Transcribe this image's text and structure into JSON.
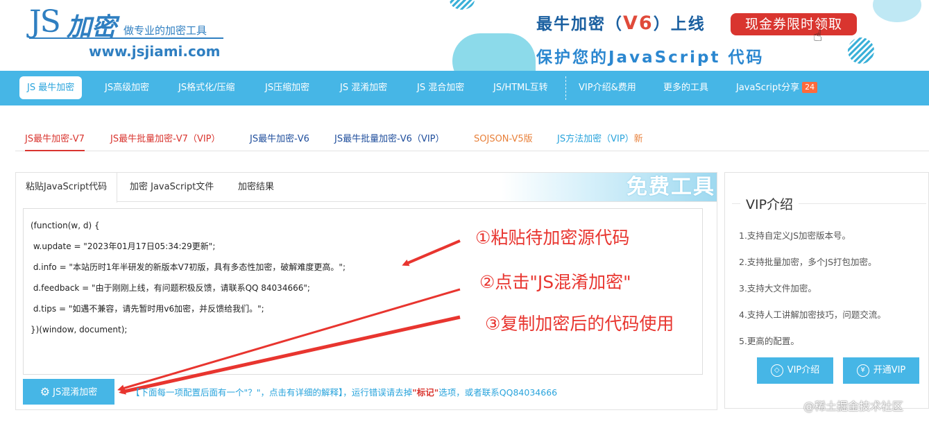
{
  "header": {
    "logo_js": "JS",
    "logo_cn": "加密",
    "logo_slogan": "做专业的加密工具",
    "logo_url": "www.jsjiami.com",
    "banner_title_pre": "最牛加密（",
    "banner_title_v6": "V6",
    "banner_title_post": "）上线",
    "banner_coupon": "现金券限时领取",
    "banner_sub": "保护您的JavaScript 代码"
  },
  "nav": {
    "items": [
      {
        "label": "JS 最牛加密"
      },
      {
        "label": "JS高级加密"
      },
      {
        "label": "JS格式化/压缩"
      },
      {
        "label": "JS压缩加密"
      },
      {
        "label": "JS 混淆加密"
      },
      {
        "label": "JS 混合加密"
      },
      {
        "label": "JS/HTML互转"
      },
      {
        "label": "VIP介绍&费用"
      },
      {
        "label": "更多的工具"
      },
      {
        "label": "JavaScript分享"
      }
    ],
    "share_badge": "24"
  },
  "subtabs": [
    {
      "label": "JS最牛加密-V7",
      "color": "#d9352f"
    },
    {
      "label": "JS最牛批量加密-V7（VIP）",
      "color": "#d9352f"
    },
    {
      "label": "JS最牛加密-V6",
      "color": "#1f4e9c"
    },
    {
      "label": "JS最牛批量加密-V6（VIP）",
      "color": "#1f4e9c"
    },
    {
      "label": "SOJSON-V5版",
      "color": "#e8803a"
    },
    {
      "label": "JS方法加密（VIP）",
      "color": "#2aa4dc"
    },
    {
      "label": "新",
      "color": "#e8803a"
    }
  ],
  "panel": {
    "tabs": [
      "粘贴JavaScript代码",
      "加密 JavaScript文件",
      "加密结果"
    ],
    "free_banner": "免费工具",
    "code_lines": [
      "(function(w, d) {",
      " w.update = \"2023年01月17日05:34:29更新\";",
      " d.info = \"本站历时1年半研发的新版本V7初版，具有多态性加密，破解难度更高。\";",
      " d.feedback = \"由于刚刚上线，有问题积极反馈，请联系QQ 84034666\";",
      " d.tips = \"如遇不兼容，请先暂时用v6加密，并反馈给我们。\";",
      "})(window, document);"
    ],
    "annotations": [
      "①粘贴待加密源代码",
      "②点击\"JS混淆加密\"",
      "③复制加密后的代码使用"
    ],
    "button_label": "JS混淆加密",
    "hint_pre": "【下面每一项配置后面有一个\"？\"，点击有详细的解释】，运行错误请去掉",
    "hint_mark": "\"标记\"",
    "hint_post": "选项，或者联系QQ84034666"
  },
  "vip": {
    "title": "VIP介绍",
    "items": [
      "1.支持自定义JS加密版本号。",
      "2.支持批量加密，多个JS打包加密。",
      "3.支持大文件加密。",
      "4.支持人工讲解加密技巧，问题交流。",
      "5.更高的配置。"
    ],
    "btn_intro": "VIP介绍",
    "btn_open": "开通VIP"
  },
  "watermark": "@稀土掘金技术社区",
  "colors": {
    "nav_bg": "#46b6e6",
    "accent_red": "#d9352f",
    "annotation_red": "#e8352f"
  }
}
